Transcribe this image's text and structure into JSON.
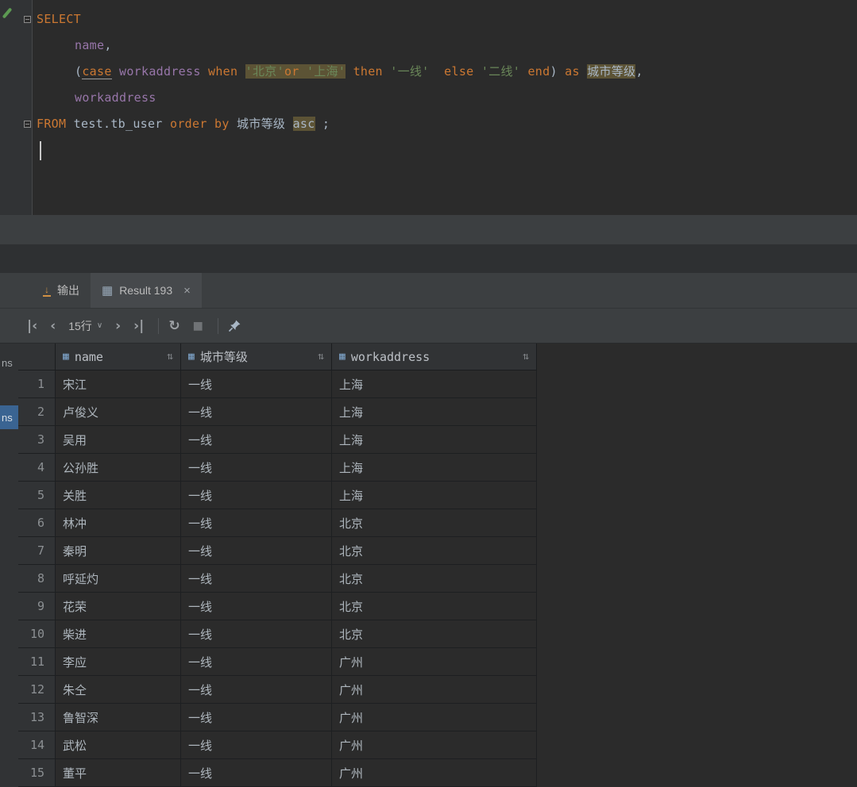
{
  "editor": {
    "lines": [
      {
        "fold": true,
        "tokens": [
          {
            "t": "SELECT",
            "c": "kw"
          }
        ]
      },
      {
        "indent": true,
        "tokens": [
          {
            "t": "name",
            "c": "id"
          },
          {
            "t": ",",
            "c": "pl"
          }
        ]
      },
      {
        "indent": true,
        "tokens": [
          {
            "t": "(",
            "c": "pl"
          },
          {
            "t": "case",
            "c": "kw u"
          },
          {
            "t": " ",
            "c": "pl"
          },
          {
            "t": "workaddress",
            "c": "id"
          },
          {
            "t": " ",
            "c": "pl"
          },
          {
            "t": "when",
            "c": "kw"
          },
          {
            "t": " ",
            "c": "pl"
          },
          {
            "t": "'北京'",
            "c": "str hl"
          },
          {
            "t": "or",
            "c": "kw hl"
          },
          {
            "t": " ",
            "c": "pl hl"
          },
          {
            "t": "'上海'",
            "c": "str hl"
          },
          {
            "t": " ",
            "c": "pl"
          },
          {
            "t": "then",
            "c": "kw"
          },
          {
            "t": " ",
            "c": "pl"
          },
          {
            "t": "'一线'",
            "c": "str"
          },
          {
            "t": "  ",
            "c": "pl"
          },
          {
            "t": "else",
            "c": "kw"
          },
          {
            "t": " ",
            "c": "pl"
          },
          {
            "t": "'二线'",
            "c": "str"
          },
          {
            "t": " ",
            "c": "pl"
          },
          {
            "t": "end",
            "c": "kw"
          },
          {
            "t": ") ",
            "c": "pl"
          },
          {
            "t": "as",
            "c": "kw"
          },
          {
            "t": " ",
            "c": "pl"
          },
          {
            "t": "城市等级",
            "c": "pl hl"
          },
          {
            "t": ",",
            "c": "pl"
          }
        ]
      },
      {
        "indent": true,
        "tokens": [
          {
            "t": "workaddress",
            "c": "id"
          }
        ]
      },
      {
        "fold": true,
        "tokens": [
          {
            "t": "FROM",
            "c": "kw"
          },
          {
            "t": " ",
            "c": "pl"
          },
          {
            "t": "test.tb_user",
            "c": "pl"
          },
          {
            "t": " ",
            "c": "pl"
          },
          {
            "t": "order",
            "c": "kw"
          },
          {
            "t": " ",
            "c": "pl"
          },
          {
            "t": "by",
            "c": "kw"
          },
          {
            "t": " ",
            "c": "pl"
          },
          {
            "t": "城市等级",
            "c": "pl"
          },
          {
            "t": " ",
            "c": "pl"
          },
          {
            "t": "asc",
            "c": "pl hl"
          },
          {
            "t": " ;",
            "c": "pl"
          }
        ]
      },
      {
        "caret": true,
        "tokens": []
      }
    ]
  },
  "stripe": {
    "fragments": [
      {
        "label": "ns",
        "active": false
      },
      {
        "label": "ns",
        "active": true
      }
    ]
  },
  "tabs": [
    {
      "label": "输出",
      "active": false
    },
    {
      "label": "Result 193",
      "active": true
    }
  ],
  "toolbar": {
    "page_size": "15行",
    "icons": {
      "first": "|‹",
      "prev": "‹",
      "next": "›",
      "last": "›|",
      "refresh": "↻",
      "stop": "■",
      "chevron": "∨",
      "close": "×",
      "output_arrow": "↓"
    }
  },
  "table": {
    "grid_glyph": "▦",
    "sort_glyph": "⇅",
    "columns": [
      {
        "label": "name"
      },
      {
        "label": "城市等级"
      },
      {
        "label": "workaddress"
      }
    ],
    "rows": [
      {
        "num": "1",
        "cells": [
          "宋江",
          "一线",
          "上海"
        ]
      },
      {
        "num": "2",
        "cells": [
          "卢俊义",
          "一线",
          "上海"
        ]
      },
      {
        "num": "3",
        "cells": [
          "吴用",
          "一线",
          "上海"
        ]
      },
      {
        "num": "4",
        "cells": [
          "公孙胜",
          "一线",
          "上海"
        ]
      },
      {
        "num": "5",
        "cells": [
          "关胜",
          "一线",
          "上海"
        ]
      },
      {
        "num": "6",
        "cells": [
          "林冲",
          "一线",
          "北京"
        ]
      },
      {
        "num": "7",
        "cells": [
          "秦明",
          "一线",
          "北京"
        ]
      },
      {
        "num": "8",
        "cells": [
          "呼延灼",
          "一线",
          "北京"
        ]
      },
      {
        "num": "9",
        "cells": [
          "花荣",
          "一线",
          "北京"
        ]
      },
      {
        "num": "10",
        "cells": [
          "柴进",
          "一线",
          "北京"
        ]
      },
      {
        "num": "11",
        "cells": [
          "李应",
          "一线",
          "广州"
        ]
      },
      {
        "num": "12",
        "cells": [
          "朱仝",
          "一线",
          "广州"
        ]
      },
      {
        "num": "13",
        "cells": [
          "鲁智深",
          "一线",
          "广州"
        ]
      },
      {
        "num": "14",
        "cells": [
          "武松",
          "一线",
          "广州"
        ]
      },
      {
        "num": "15",
        "cells": [
          "董平",
          "一线",
          "广州"
        ]
      }
    ]
  },
  "colors": {
    "editor_bg": "#2b2b2b",
    "panel_bg": "#3c3f41",
    "header_bg": "#313335",
    "keyword": "#cc7832",
    "identifier": "#9876aa",
    "string": "#6a8759",
    "highlight_bg": "#5c5335",
    "stripe_active_bg": "#3a6492"
  }
}
